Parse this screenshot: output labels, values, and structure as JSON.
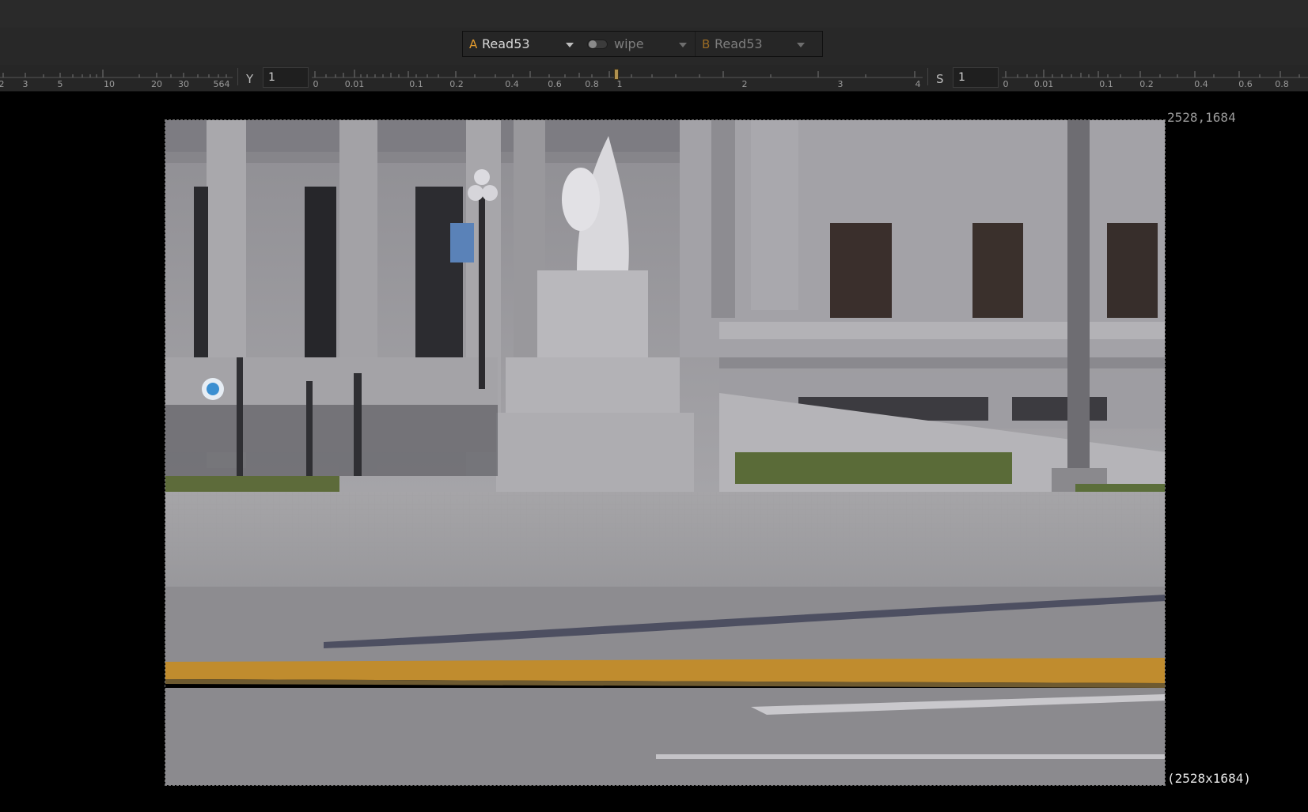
{
  "compare": {
    "a_letter": "A",
    "a_input": "Read53",
    "mode": "wipe",
    "b_letter": "B",
    "b_input": "Read53"
  },
  "gain_ruler": {
    "ticks": [
      "2",
      "3",
      "5",
      "10",
      "20",
      "30",
      "564"
    ]
  },
  "gamma": {
    "label": "Y",
    "value": "1",
    "ticks": [
      "0",
      "0.01",
      "0.1",
      "0.2",
      "0.4",
      "0.6",
      "0.8",
      "1",
      "2",
      "3",
      "4"
    ]
  },
  "saturation": {
    "label": "S",
    "value": "1",
    "ticks": [
      "0",
      "0.01",
      "0.1",
      "0.2",
      "0.4",
      "0.6",
      "0.8"
    ]
  },
  "viewer": {
    "top_right_coords": "2528,1684",
    "format_label": "(2528x1684)"
  },
  "colors": {
    "accent": "#e39b2e",
    "background": "#000000",
    "toolbar": "#282828"
  }
}
